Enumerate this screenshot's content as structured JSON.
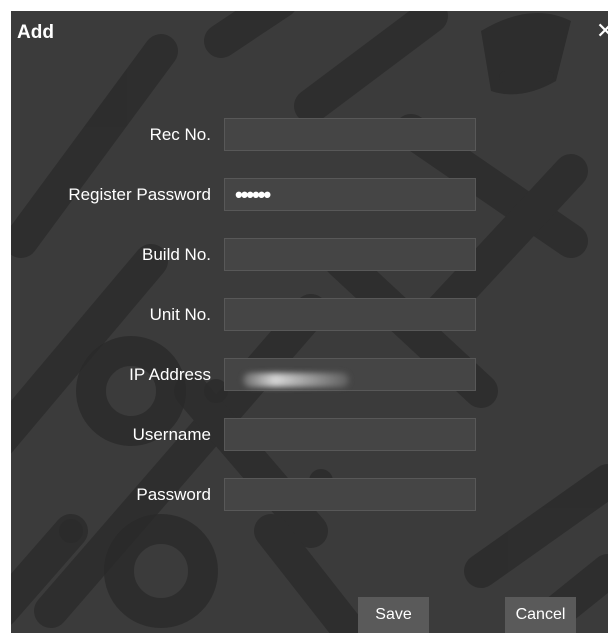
{
  "dialog": {
    "title": "Add",
    "close_icon": "close-icon",
    "close_glyph": "✕"
  },
  "fields": {
    "rec_no": {
      "label": "Rec No.",
      "value": ""
    },
    "register_password": {
      "label": "Register Password",
      "value": "••••••"
    },
    "build_no": {
      "label": "Build No.",
      "value": ""
    },
    "unit_no": {
      "label": "Unit No.",
      "value": ""
    },
    "ip_address": {
      "label": "IP Address",
      "value": ""
    },
    "username": {
      "label": "Username",
      "value": ""
    },
    "password": {
      "label": "Password",
      "value": ""
    }
  },
  "buttons": {
    "save": "Save",
    "cancel": "Cancel"
  },
  "colors": {
    "dialog_background": "#3b3b3b",
    "input_background": "#454545",
    "button_background": "#5a5a5a",
    "text": "#ffffff"
  }
}
